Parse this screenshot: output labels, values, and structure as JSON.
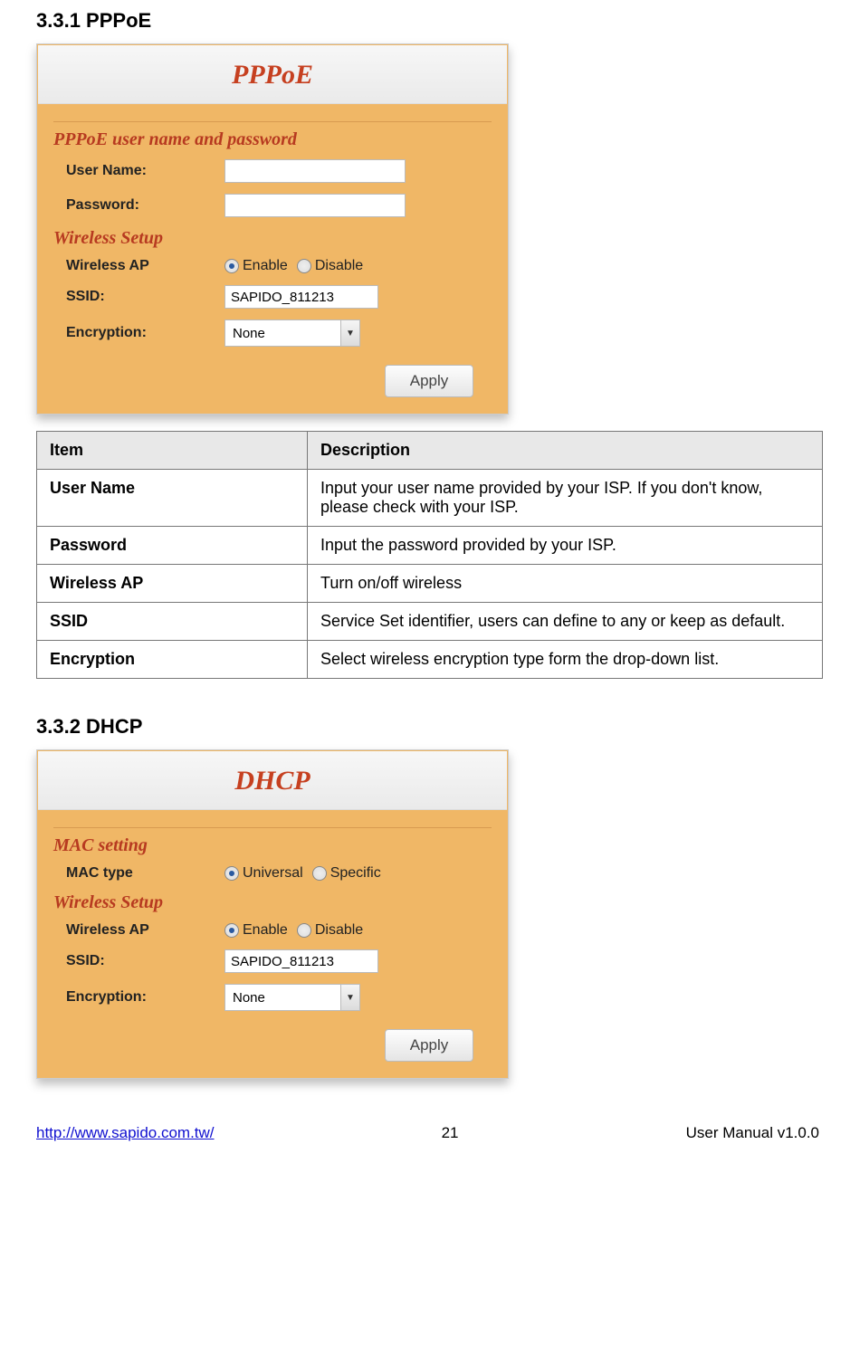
{
  "sections": {
    "pppoe": {
      "heading": "3.3.1    PPPoE",
      "panel_title": "PPPoE",
      "group1": "PPPoE user name and password",
      "username_label": "User Name:",
      "password_label": "Password:",
      "group2": "Wireless Setup",
      "wireless_ap_label": "Wireless AP",
      "enable_label": "Enable",
      "disable_label": "Disable",
      "ssid_label": "SSID:",
      "ssid_value": "SAPIDO_811213",
      "encryption_label": "Encryption:",
      "encryption_value": "None",
      "apply_label": "Apply"
    },
    "desc_table": {
      "header_item": "Item",
      "header_desc": "Description",
      "rows": [
        {
          "item": "User Name",
          "desc": "Input your user name provided by your ISP. If you don't know, please check with your ISP."
        },
        {
          "item": "Password",
          "desc": "Input the password provided by your ISP."
        },
        {
          "item": "Wireless AP",
          "desc": "Turn on/off wireless"
        },
        {
          "item": "SSID",
          "desc": "Service Set identifier, users can define to any or keep as default."
        },
        {
          "item": "Encryption",
          "desc": "Select wireless encryption type form the drop-down list."
        }
      ]
    },
    "dhcp": {
      "heading": "3.3.2    DHCP",
      "panel_title": "DHCP",
      "group1": "MAC setting",
      "mac_type_label": "MAC type",
      "universal_label": "Universal",
      "specific_label": "Specific",
      "group2": "Wireless Setup",
      "wireless_ap_label": "Wireless AP",
      "enable_label": "Enable",
      "disable_label": "Disable",
      "ssid_label": "SSID:",
      "ssid_value": "SAPIDO_811213",
      "encryption_label": "Encryption:",
      "encryption_value": "None",
      "apply_label": "Apply"
    }
  },
  "footer": {
    "url": "http://www.sapido.com.tw/",
    "page_number": "21",
    "version": "User Manual v1.0.0"
  }
}
